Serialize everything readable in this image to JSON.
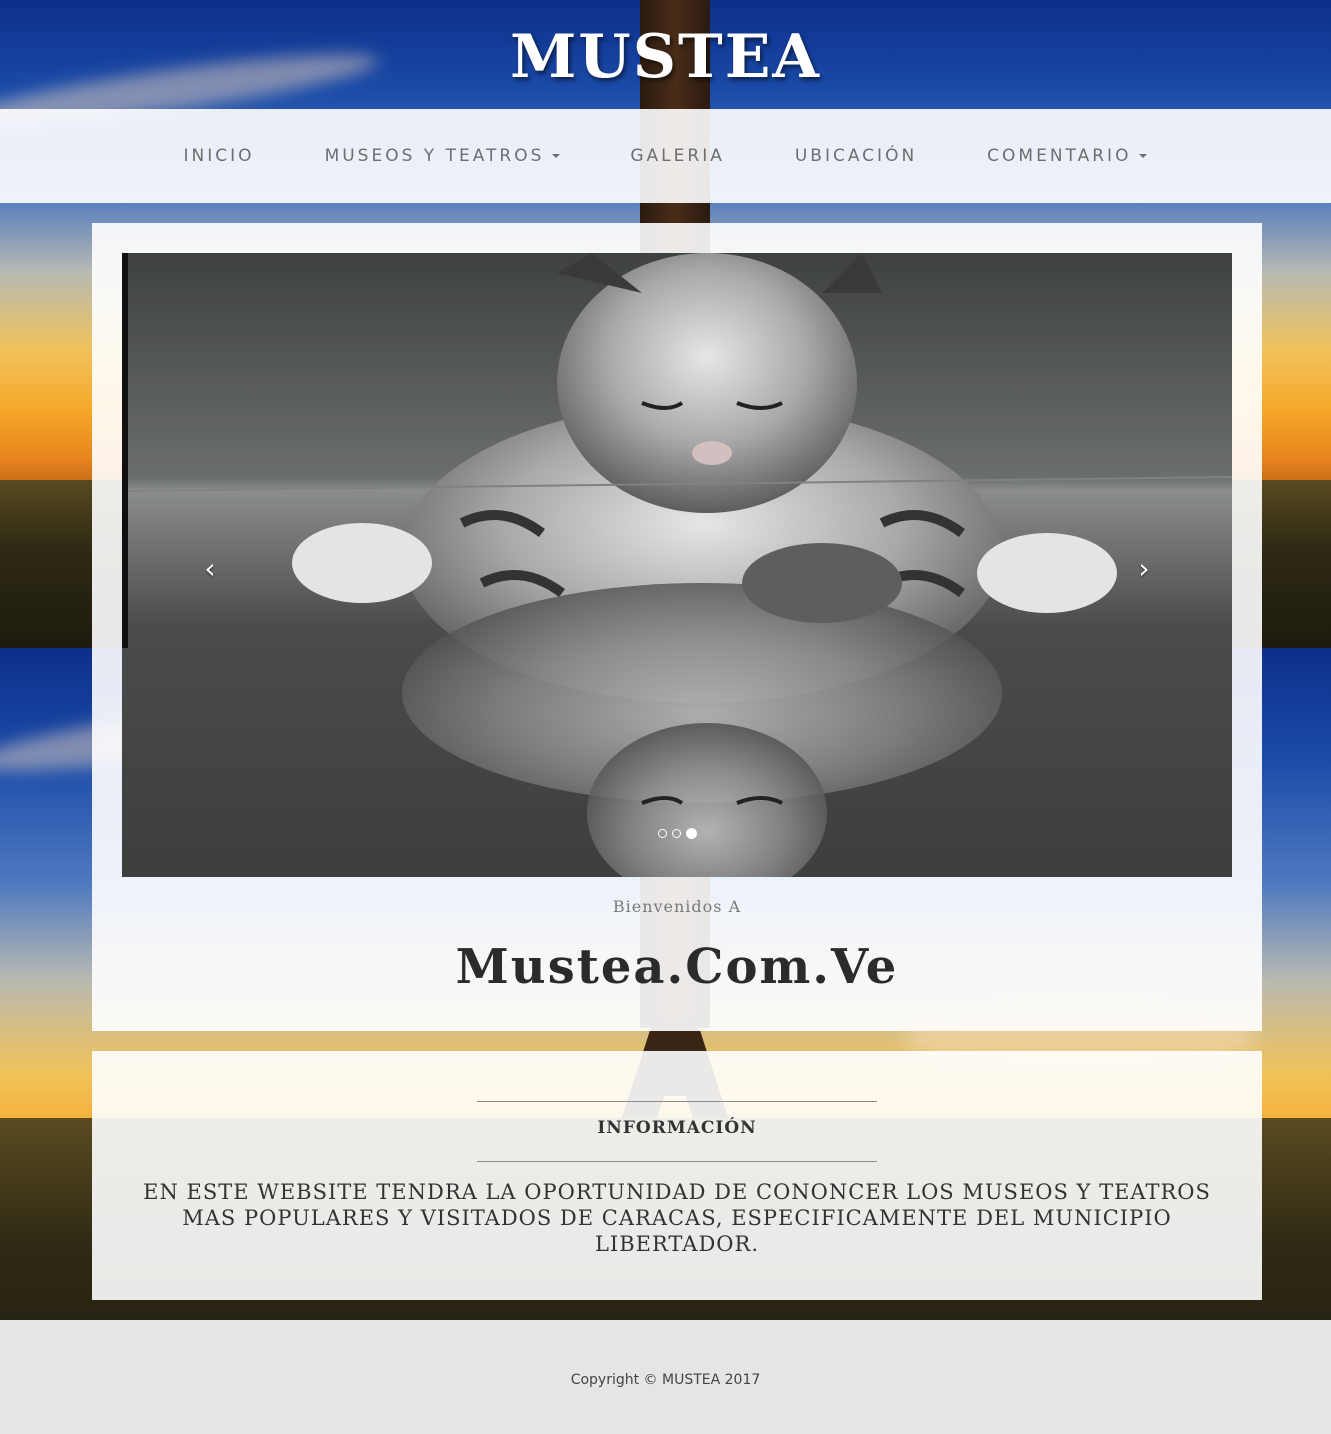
{
  "site": {
    "title": "MUSTEA"
  },
  "nav": {
    "items": [
      {
        "label": "INICIO",
        "dropdown": false
      },
      {
        "label": "MUSEOS Y TEATROS",
        "dropdown": true
      },
      {
        "label": "GALERIA",
        "dropdown": false
      },
      {
        "label": "UBICACIÓN",
        "dropdown": false
      },
      {
        "label": "COMENTARIO",
        "dropdown": true
      }
    ]
  },
  "carousel": {
    "prev_label": "‹",
    "next_label": "›",
    "slide_count": 3,
    "active_index": 2,
    "image_subject": "tabby kitten reflected on glass"
  },
  "welcome": {
    "subtitle": "Bienvenidos A",
    "title": "Mustea.Com.Ve"
  },
  "info": {
    "heading": "INFORMACIÓN",
    "text": "EN ESTE WEBSITE TENDRA LA OPORTUNIDAD DE CONONCER LOS MUSEOS Y TEATROS MAS POPULARES Y VISITADOS DE CARACAS, ESPECIFICAMENTE DEL MUNICIPIO LIBERTADOR."
  },
  "footer": {
    "copyright": "Copyright © MUSTEA 2017"
  },
  "colors": {
    "nav_text": "#6e6e6e",
    "heading_text": "#2b2b2b",
    "panel_bg": "#ffffff"
  }
}
